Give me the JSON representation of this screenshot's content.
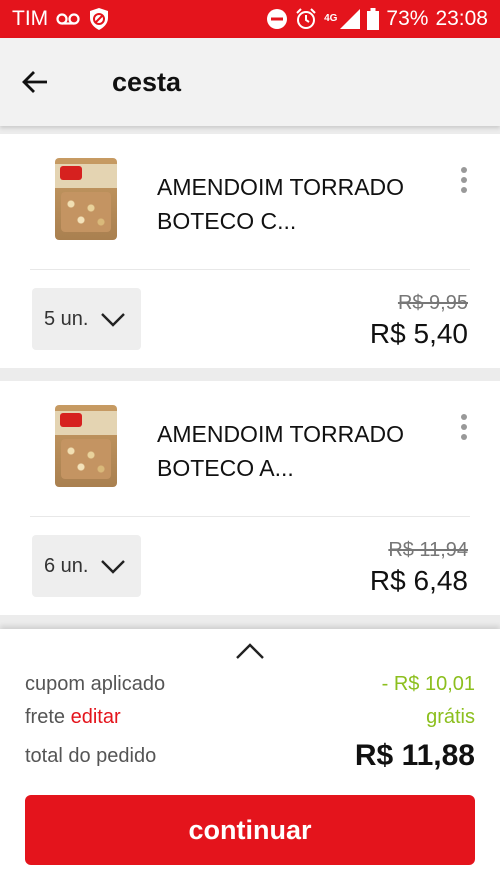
{
  "status_bar": {
    "carrier": "TIM",
    "network": "4G",
    "battery": "73%",
    "time": "23:08",
    "icons": [
      "voicemail-icon",
      "shield-icon",
      "do-not-disturb-icon",
      "alarm-icon",
      "signal-icon",
      "battery-icon"
    ]
  },
  "header": {
    "title": "cesta",
    "back_icon": "arrow-left-icon"
  },
  "items": [
    {
      "name": "AMENDOIM TORRADO BOTECO C...",
      "quantity": "5 un.",
      "old_price": "R$ 9,95",
      "price": "R$ 5,40"
    },
    {
      "name": "AMENDOIM TORRADO BOTECO A...",
      "quantity": "6 un.",
      "old_price": "R$ 11,94",
      "price": "R$ 6,48"
    }
  ],
  "summary": {
    "coupon_label": "cupom aplicado",
    "coupon_value": "- R$ 10,01",
    "shipping_label": "frete",
    "shipping_edit": "editar",
    "shipping_value": "grátis",
    "total_label": "total do pedido",
    "total_value": "R$ 11,88"
  },
  "cta": {
    "label": "continuar"
  },
  "colors": {
    "brand_red": "#e4141c",
    "discount_green": "#8cbf1e"
  }
}
